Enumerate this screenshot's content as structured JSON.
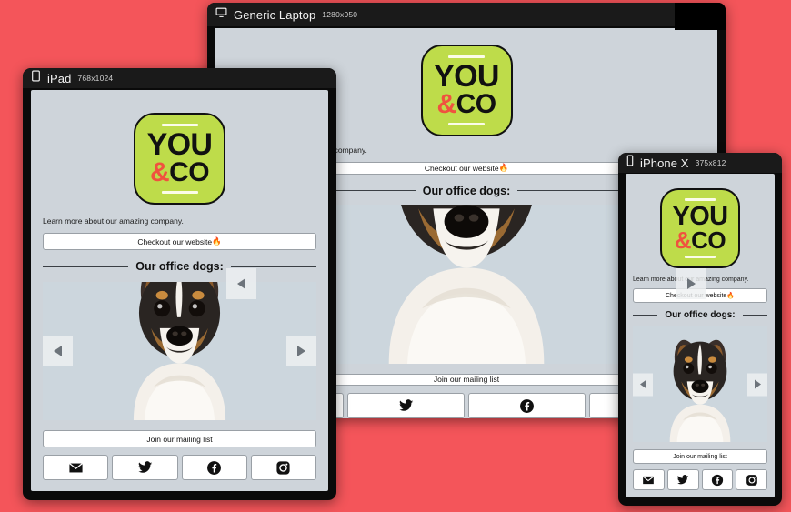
{
  "background_color": "#f4555a",
  "devices": [
    {
      "id": "laptop",
      "name": "Generic Laptop",
      "dimensions": "1280x950",
      "icon": "monitor-icon"
    },
    {
      "id": "ipad",
      "name": "iPad",
      "dimensions": "768x1024",
      "icon": "tablet-icon"
    },
    {
      "id": "iphone",
      "name": "iPhone X",
      "dimensions": "375x812",
      "icon": "phone-icon"
    }
  ],
  "page": {
    "logo": {
      "line1": "YOU",
      "amp": "&",
      "line2": "CO",
      "background_color": "#bedc4a",
      "amp_color": "#f0523f",
      "text_color": "#111111"
    },
    "lead_text": "Learn more about our amazing company.",
    "website_button": "Checkout our website ",
    "website_button_emoji": "🔥",
    "section_divider": "Our office dogs:",
    "carousel": {
      "prev_label": "◀",
      "next_label": "▶",
      "image_alt": "Jack Russell terrier dog portrait on light blue-gray background"
    },
    "mailing_button": "Join our mailing list",
    "social_buttons": [
      {
        "name": "email-icon",
        "label": "Email"
      },
      {
        "name": "twitter-icon",
        "label": "Twitter"
      },
      {
        "name": "facebook-icon",
        "label": "Facebook"
      },
      {
        "name": "instagram-icon",
        "label": "Instagram"
      }
    ]
  }
}
